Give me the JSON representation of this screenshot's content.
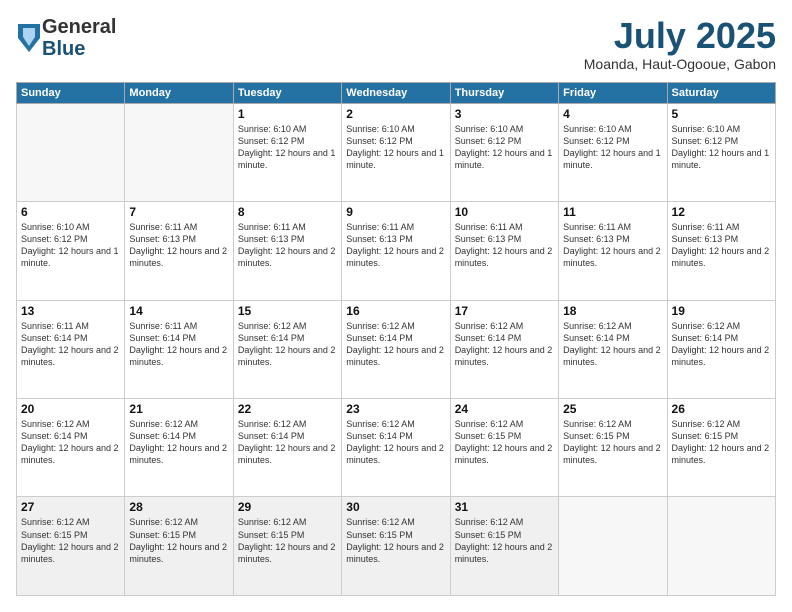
{
  "logo": {
    "general": "General",
    "blue": "Blue"
  },
  "header": {
    "month": "July 2025",
    "location": "Moanda, Haut-Ogooue, Gabon"
  },
  "days_of_week": [
    "Sunday",
    "Monday",
    "Tuesday",
    "Wednesday",
    "Thursday",
    "Friday",
    "Saturday"
  ],
  "weeks": [
    [
      {
        "day": "",
        "info": ""
      },
      {
        "day": "",
        "info": ""
      },
      {
        "day": "1",
        "info": "Sunrise: 6:10 AM\nSunset: 6:12 PM\nDaylight: 12 hours and 1 minute."
      },
      {
        "day": "2",
        "info": "Sunrise: 6:10 AM\nSunset: 6:12 PM\nDaylight: 12 hours and 1 minute."
      },
      {
        "day": "3",
        "info": "Sunrise: 6:10 AM\nSunset: 6:12 PM\nDaylight: 12 hours and 1 minute."
      },
      {
        "day": "4",
        "info": "Sunrise: 6:10 AM\nSunset: 6:12 PM\nDaylight: 12 hours and 1 minute."
      },
      {
        "day": "5",
        "info": "Sunrise: 6:10 AM\nSunset: 6:12 PM\nDaylight: 12 hours and 1 minute."
      }
    ],
    [
      {
        "day": "6",
        "info": "Sunrise: 6:10 AM\nSunset: 6:12 PM\nDaylight: 12 hours and 1 minute."
      },
      {
        "day": "7",
        "info": "Sunrise: 6:11 AM\nSunset: 6:13 PM\nDaylight: 12 hours and 2 minutes."
      },
      {
        "day": "8",
        "info": "Sunrise: 6:11 AM\nSunset: 6:13 PM\nDaylight: 12 hours and 2 minutes."
      },
      {
        "day": "9",
        "info": "Sunrise: 6:11 AM\nSunset: 6:13 PM\nDaylight: 12 hours and 2 minutes."
      },
      {
        "day": "10",
        "info": "Sunrise: 6:11 AM\nSunset: 6:13 PM\nDaylight: 12 hours and 2 minutes."
      },
      {
        "day": "11",
        "info": "Sunrise: 6:11 AM\nSunset: 6:13 PM\nDaylight: 12 hours and 2 minutes."
      },
      {
        "day": "12",
        "info": "Sunrise: 6:11 AM\nSunset: 6:13 PM\nDaylight: 12 hours and 2 minutes."
      }
    ],
    [
      {
        "day": "13",
        "info": "Sunrise: 6:11 AM\nSunset: 6:14 PM\nDaylight: 12 hours and 2 minutes."
      },
      {
        "day": "14",
        "info": "Sunrise: 6:11 AM\nSunset: 6:14 PM\nDaylight: 12 hours and 2 minutes."
      },
      {
        "day": "15",
        "info": "Sunrise: 6:12 AM\nSunset: 6:14 PM\nDaylight: 12 hours and 2 minutes."
      },
      {
        "day": "16",
        "info": "Sunrise: 6:12 AM\nSunset: 6:14 PM\nDaylight: 12 hours and 2 minutes."
      },
      {
        "day": "17",
        "info": "Sunrise: 6:12 AM\nSunset: 6:14 PM\nDaylight: 12 hours and 2 minutes."
      },
      {
        "day": "18",
        "info": "Sunrise: 6:12 AM\nSunset: 6:14 PM\nDaylight: 12 hours and 2 minutes."
      },
      {
        "day": "19",
        "info": "Sunrise: 6:12 AM\nSunset: 6:14 PM\nDaylight: 12 hours and 2 minutes."
      }
    ],
    [
      {
        "day": "20",
        "info": "Sunrise: 6:12 AM\nSunset: 6:14 PM\nDaylight: 12 hours and 2 minutes."
      },
      {
        "day": "21",
        "info": "Sunrise: 6:12 AM\nSunset: 6:14 PM\nDaylight: 12 hours and 2 minutes."
      },
      {
        "day": "22",
        "info": "Sunrise: 6:12 AM\nSunset: 6:14 PM\nDaylight: 12 hours and 2 minutes."
      },
      {
        "day": "23",
        "info": "Sunrise: 6:12 AM\nSunset: 6:14 PM\nDaylight: 12 hours and 2 minutes."
      },
      {
        "day": "24",
        "info": "Sunrise: 6:12 AM\nSunset: 6:15 PM\nDaylight: 12 hours and 2 minutes."
      },
      {
        "day": "25",
        "info": "Sunrise: 6:12 AM\nSunset: 6:15 PM\nDaylight: 12 hours and 2 minutes."
      },
      {
        "day": "26",
        "info": "Sunrise: 6:12 AM\nSunset: 6:15 PM\nDaylight: 12 hours and 2 minutes."
      }
    ],
    [
      {
        "day": "27",
        "info": "Sunrise: 6:12 AM\nSunset: 6:15 PM\nDaylight: 12 hours and 2 minutes."
      },
      {
        "day": "28",
        "info": "Sunrise: 6:12 AM\nSunset: 6:15 PM\nDaylight: 12 hours and 2 minutes."
      },
      {
        "day": "29",
        "info": "Sunrise: 6:12 AM\nSunset: 6:15 PM\nDaylight: 12 hours and 2 minutes."
      },
      {
        "day": "30",
        "info": "Sunrise: 6:12 AM\nSunset: 6:15 PM\nDaylight: 12 hours and 2 minutes."
      },
      {
        "day": "31",
        "info": "Sunrise: 6:12 AM\nSunset: 6:15 PM\nDaylight: 12 hours and 2 minutes."
      },
      {
        "day": "",
        "info": ""
      },
      {
        "day": "",
        "info": ""
      }
    ]
  ]
}
